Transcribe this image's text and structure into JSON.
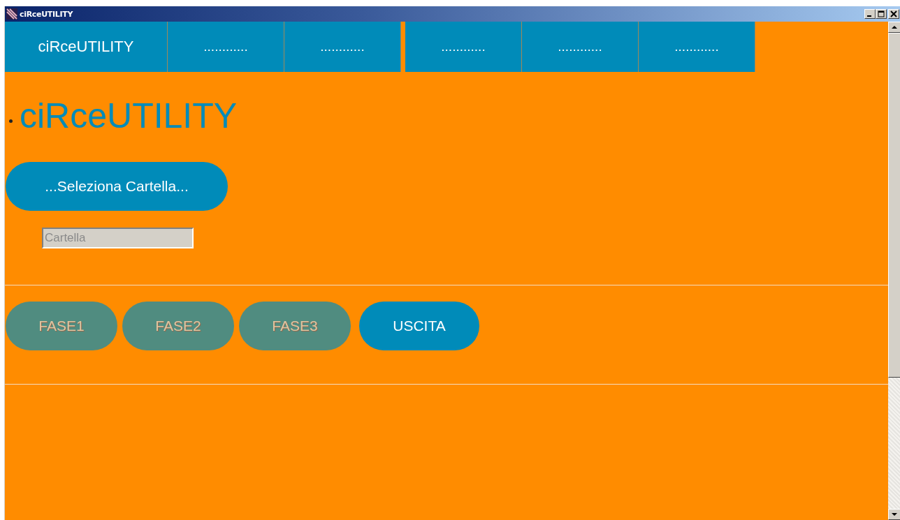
{
  "window": {
    "title": "ciRceUTILITY"
  },
  "nav": [
    {
      "label": "ciRceUTILITY"
    },
    {
      "label": "............"
    },
    {
      "label": "............"
    },
    {
      "label": "............"
    },
    {
      "label": "............"
    },
    {
      "label": "............"
    }
  ],
  "heading": "ciRceUTILITY",
  "select_button": "...Seleziona Cartella...",
  "folder_field": {
    "placeholder": "Cartella",
    "disabled": true
  },
  "actions": [
    {
      "label": "FASE1",
      "disabled": true
    },
    {
      "label": "FASE2",
      "disabled": true
    },
    {
      "label": "FASE3",
      "disabled": true
    },
    {
      "label": "USCITA",
      "disabled": false
    }
  ]
}
